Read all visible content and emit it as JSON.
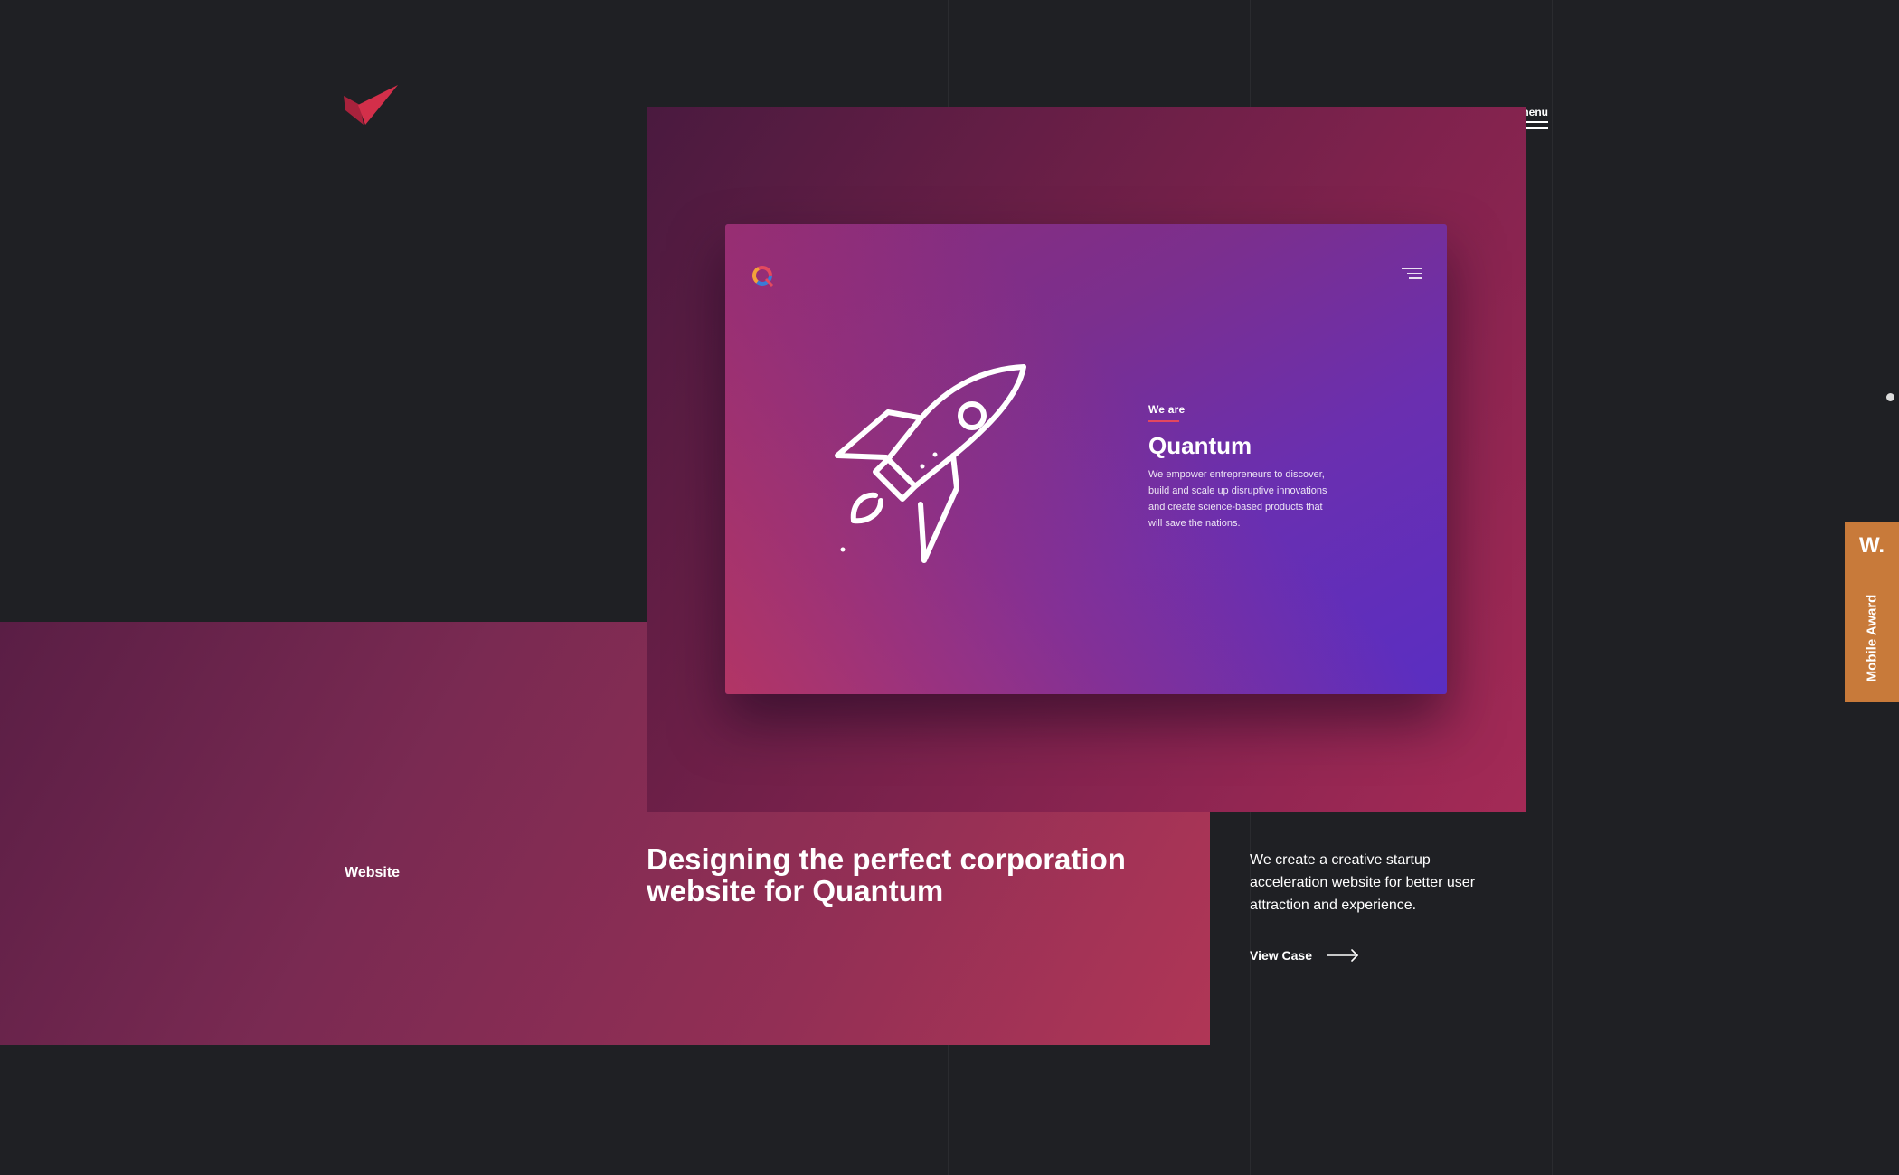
{
  "header": {
    "menu_label": "menu"
  },
  "hero": {
    "screen": {
      "eyebrow": "We are",
      "title": "Quantum",
      "description": "We empower entrepreneurs to discover, build and scale up disruptive innovations and create science-based products that will save the nations."
    }
  },
  "project": {
    "category": "Website",
    "headline": "Designing the perfect corporation website for Quantum",
    "description": "We create a creative startup acceleration website for better user attraction and experience.",
    "cta_label": "View Case"
  },
  "award_badge": {
    "letter": "W.",
    "label": "Mobile Award"
  },
  "colors": {
    "background": "#1f2024",
    "accent_red": "#c42a45",
    "award_orange": "#c87a3a"
  }
}
